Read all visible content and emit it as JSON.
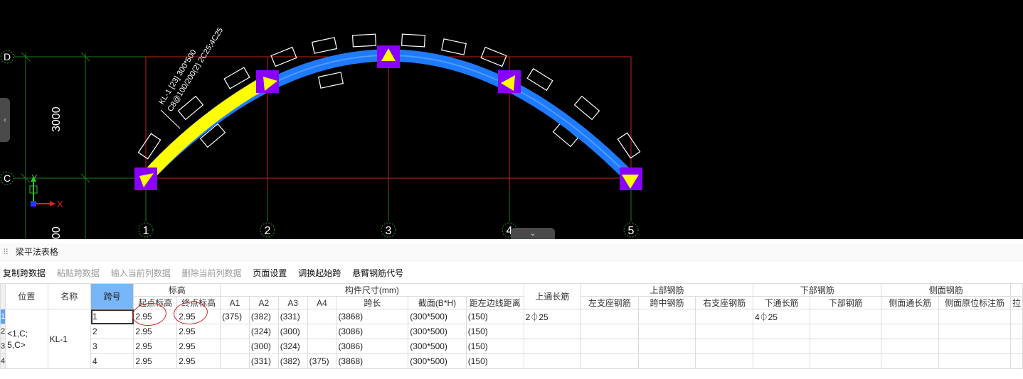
{
  "cad": {
    "axis_letters": [
      "D",
      "C"
    ],
    "axis_numbers": [
      "1",
      "2",
      "3",
      "4",
      "5"
    ],
    "dimension_label": "3000",
    "dimension_label_bottom": "00",
    "beam_annotation_line1": "KL-1 [23] 300*500",
    "beam_annotation_line2": "C8@100/200(2) 2C25;4C25",
    "ucs_x": "X",
    "ucs_y": "Y",
    "colors": {
      "background": "#000000",
      "grid": "#c81e1e",
      "beam_selected": "#ffff00",
      "beam": "#1e7bff",
      "node": "#8a00ff",
      "node_arrow": "#ffff00",
      "axis_circle": "#2a9d2a",
      "green_line": "#1d7a1d"
    },
    "side_tab_icon": "chevron-left-icon",
    "bottom_tab_icon": "chevron-down-icon"
  },
  "panel": {
    "title": "梁平法表格",
    "toolbar": [
      {
        "label": "复制跨数据",
        "enabled": true
      },
      {
        "label": "粘贴跨数据",
        "enabled": false
      },
      {
        "label": "输入当前列数据",
        "enabled": false
      },
      {
        "label": "删除当前列数据",
        "enabled": false
      },
      {
        "label": "页面设置",
        "enabled": true
      },
      {
        "label": "调换起始跨",
        "enabled": true
      },
      {
        "label": "悬臂钢筋代号",
        "enabled": true
      }
    ],
    "headers": {
      "position": "位置",
      "name": "名称",
      "span": "跨号",
      "elevation": "标高",
      "start_elev": "起点标高",
      "end_elev": "终点标高",
      "dims": "构件尺寸(mm)",
      "a1": "A1",
      "a2": "A2",
      "a3": "A3",
      "a4": "A4",
      "span_len": "跨长",
      "section": "截面(B*H)",
      "left_dist": "距左边线距离",
      "top_through": "上通长筋",
      "top_rebar": "上部钢筋",
      "left_support": "左支座钢筋",
      "mid": "跨中钢筋",
      "right_support": "右支座钢筋",
      "bottom_rebar": "下部钢筋",
      "bottom_through": "下通长筋",
      "bottom": "下部钢筋",
      "side_rebar": "侧面钢筋",
      "side_through": "侧面通长筋",
      "side_original": "侧面原位标注筋",
      "extra": "拉"
    },
    "row_numbers": [
      "1",
      "2",
      "3",
      "4"
    ],
    "position_value": "<1,C;\n5,C>",
    "name_value": "KL-1",
    "rows": [
      {
        "span": "1",
        "start": "2.95",
        "end": "2.95",
        "a1": "(375)",
        "a2": "(382)",
        "a3": "(331)",
        "a4": "",
        "len": "(3868)",
        "section": "(300*500)",
        "dist": "(150)",
        "top_through": "2⏀25",
        "bottom_through": "4⏀25"
      },
      {
        "span": "2",
        "start": "2.95",
        "end": "2.95",
        "a1": "",
        "a2": "(324)",
        "a3": "(300)",
        "a4": "",
        "len": "(3086)",
        "section": "(300*500)",
        "dist": "(150)",
        "top_through": "",
        "bottom_through": ""
      },
      {
        "span": "3",
        "start": "2.95",
        "end": "2.95",
        "a1": "",
        "a2": "(300)",
        "a3": "(324)",
        "a4": "",
        "len": "(3086)",
        "section": "(300*500)",
        "dist": "(150)",
        "top_through": "",
        "bottom_through": ""
      },
      {
        "span": "4",
        "start": "2.95",
        "end": "2.95",
        "a1": "",
        "a2": "(331)",
        "a3": "(382)",
        "a4": "(375)",
        "len": "(3868)",
        "section": "(300*500)",
        "dist": "(150)",
        "top_through": "",
        "bottom_through": ""
      }
    ]
  }
}
